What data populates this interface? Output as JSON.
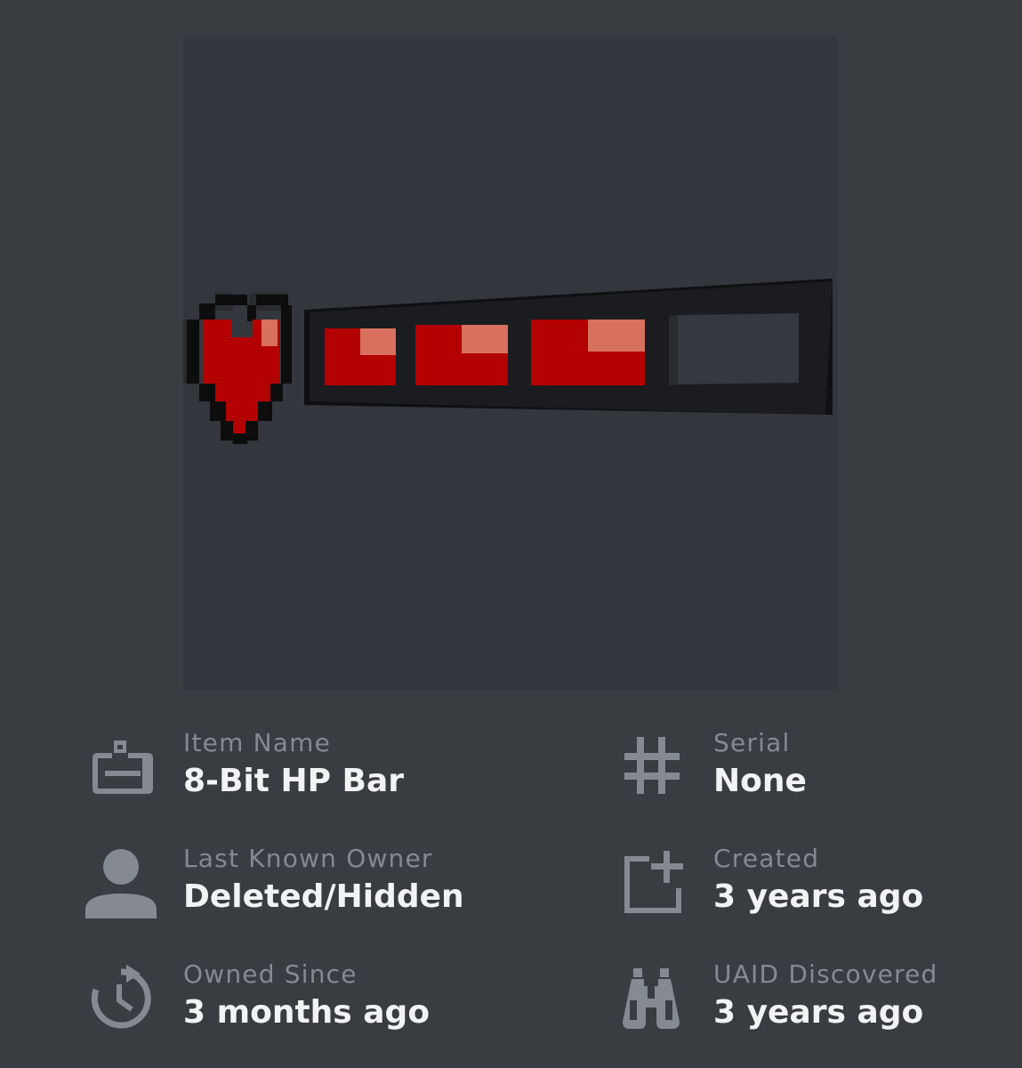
{
  "item_image": {
    "icon": "8-bit-hp-bar-thumbnail",
    "colors": {
      "background": "#33363c",
      "frame": "#141517",
      "health_red": "#b30000",
      "highlight": "#d8705f"
    }
  },
  "details": {
    "item_name": {
      "label": "Item Name",
      "value": "8-Bit HP Bar",
      "icon": "id-badge-icon"
    },
    "serial": {
      "label": "Serial",
      "value": "None",
      "icon": "hash-icon"
    },
    "last_known_owner": {
      "label": "Last Known Owner",
      "value": "Deleted/Hidden",
      "icon": "user-icon"
    },
    "created": {
      "label": "Created",
      "value": "3 years ago",
      "icon": "add-box-icon"
    },
    "owned_since": {
      "label": "Owned Since",
      "value": "3 months ago",
      "icon": "history-clock-icon"
    },
    "uaid_discovered": {
      "label": "UAID Discovered",
      "value": "3 years ago",
      "icon": "binoculars-icon"
    }
  },
  "colors": {
    "page_background": "#393c41",
    "label": "#858a92",
    "value": "#f2f3f5",
    "icon": "#858a92"
  }
}
